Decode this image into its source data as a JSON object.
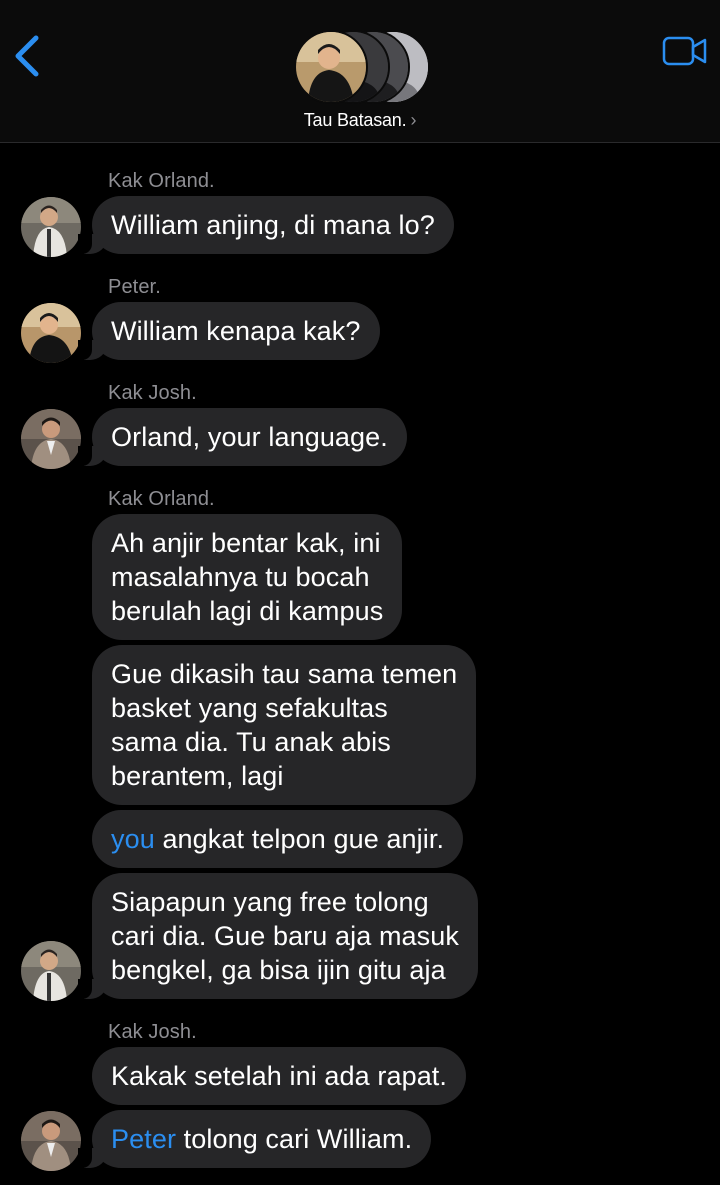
{
  "header": {
    "title": "Tau Batasan.",
    "chevron": "›",
    "back_icon": "chevron-left-icon",
    "video_icon": "video-camera-icon",
    "accent_color": "#2b8ef0"
  },
  "messages": [
    {
      "sender": "Kak Orland.",
      "text": "William anjing, di mana lo?"
    },
    {
      "sender": "Peter.",
      "text": "William kenapa kak?"
    },
    {
      "sender": "Kak Josh.",
      "text": "Orland, your language."
    },
    {
      "sender": "Kak Orland.",
      "text": "Ah anjir bentar kak, ini\nmasalahnya tu bocah\nberulah lagi di kampus"
    },
    {
      "text": "Gue dikasih tau sama temen\nbasket yang sefakultas\nsama dia. Tu anak abis\nberantem, lagi"
    },
    {
      "mention": "you",
      "text": " angkat telpon gue anjir."
    },
    {
      "text": "Siapapun yang free tolong\ncari dia. Gue baru aja masuk\nbengkel, ga bisa ijin gitu aja"
    },
    {
      "sender": "Kak Josh.",
      "text": "Kakak setelah ini ada rapat."
    },
    {
      "mention": "Peter",
      "text": " tolong cari William."
    }
  ]
}
